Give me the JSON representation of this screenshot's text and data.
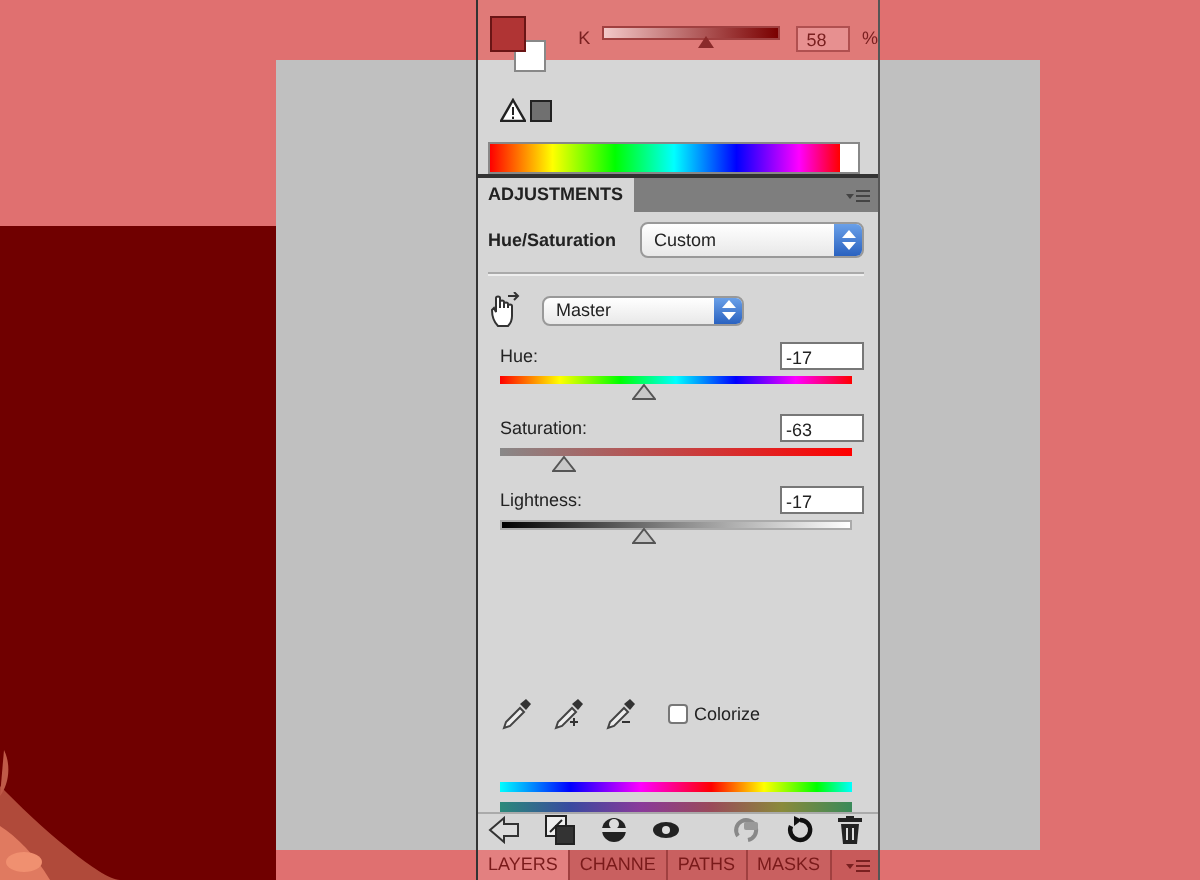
{
  "color_panel": {
    "channel_label": "K",
    "level": 0.58,
    "channel_value": "58",
    "unit": "%"
  },
  "adjustments": {
    "tabs": [
      {
        "label": "ADJUSTMENTS",
        "selected": true
      }
    ],
    "title": "Hue/Saturation",
    "preset": "Custom",
    "range": "Master",
    "sliders": [
      {
        "kind": "hue",
        "label": "Hue:",
        "value": "-17",
        "level": 0.41
      },
      {
        "kind": "saturation",
        "label": "Saturation:",
        "value": "-63",
        "level": 0.18
      },
      {
        "kind": "lightness",
        "label": "Lightness:",
        "value": "-17",
        "level": 0.41
      }
    ],
    "colorize": {
      "label": "Colorize",
      "checked": false
    }
  },
  "bottom_tabs": [
    {
      "label": "LAYERS",
      "selected": true
    },
    {
      "label": "CHANNE",
      "selected": false
    },
    {
      "label": "PATHS",
      "selected": false
    },
    {
      "label": "MASKS",
      "selected": false
    }
  ]
}
